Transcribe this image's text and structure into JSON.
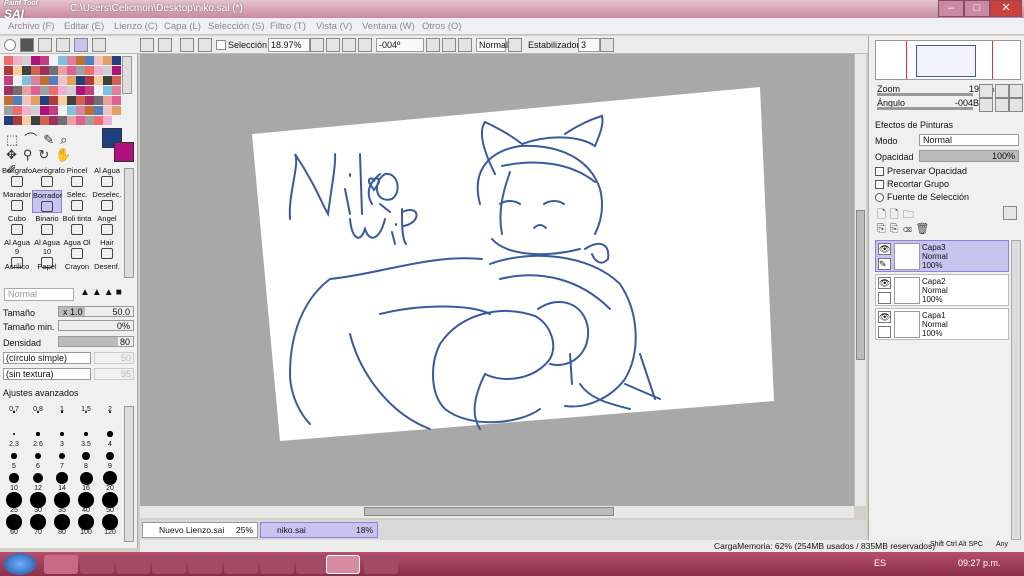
{
  "window": {
    "logo_small": "Paint Tool",
    "logo_big": "SAI",
    "title": "C:\\Users\\Celicmon\\Desktop\\niko.sai (*)",
    "minimize": "–",
    "maximize": "□",
    "close": "✕"
  },
  "menu": [
    "Archivo (F)",
    "Editar (E)",
    "Lienzo (C)",
    "Capa (L)",
    "Selección (S)",
    "Filtro (T)",
    "Vista (V)",
    "Ventana (W)",
    "Otros (O)"
  ],
  "toolbar": {
    "selection_label": "Selección",
    "zoom": "18.97%",
    "angle": "-004º",
    "blend": "Normal",
    "stabilizer_label": "Estabilizador",
    "stabilizer": "3"
  },
  "tools": [
    [
      "Bolígrafo",
      "Aerógrafo",
      "Pincel",
      "Al Agua"
    ],
    [
      "Marador",
      "Borrador",
      "Selec.",
      "Deselec."
    ],
    [
      "Cubo",
      "Binario",
      "Boli tinta",
      "Angel"
    ],
    [
      "Al Agua 9",
      "Al Agua 10",
      "Agua Ol",
      "Hair"
    ],
    [
      "Acrílico",
      "Papel",
      "Crayon",
      "Desenf."
    ]
  ],
  "brush": {
    "mode": "Normal",
    "size_label": "Tamaño",
    "size_mult": "x 1.0",
    "size": "50.0",
    "min_label": "Tamaño min.",
    "min": "0%",
    "density_label": "Densidad",
    "density": "80",
    "shape": "(círculo simple)",
    "shape_val": "50",
    "texture": "(sin textura)",
    "texture_val": "95",
    "advanced": "Ajustes avanzados"
  },
  "dot_labels": [
    "0.7",
    "0.8",
    "1",
    "1.5",
    "2",
    "2.3",
    "2.6",
    "3",
    "3.5",
    "4",
    "5",
    "6",
    "7",
    "8",
    "9",
    "10",
    "12",
    "14",
    "16",
    "20",
    "25",
    "30",
    "35",
    "40",
    "50",
    "60",
    "70",
    "80",
    "100",
    "120"
  ],
  "navigator": {
    "zoom_label": "Zoom",
    "zoom": "19.0%",
    "angle_label": "Ángulo",
    "angle": "-004B"
  },
  "layer_panel": {
    "effects": "Efectos de Pinturas",
    "mode_label": "Modo",
    "mode": "Normal",
    "opacity_label": "Opacidad",
    "opacity": "100%",
    "preserve": "Preservar Opacidad",
    "clip": "Recortar Grupo",
    "source": "Fuente de Selección"
  },
  "layers": [
    {
      "name": "Capa3",
      "mode": "Normal",
      "opacity": "100%"
    },
    {
      "name": "Capa2",
      "mode": "Normal",
      "opacity": "100%"
    },
    {
      "name": "Capa1",
      "mode": "Normal",
      "opacity": "100%"
    }
  ],
  "documents": [
    {
      "name": "Nuevo Lienzo.sai",
      "zoom": "25%"
    },
    {
      "name": "niko.sai",
      "zoom": "18%"
    }
  ],
  "status": {
    "memory": "CargaMemoria: 62% (254MB usados / 835MB reservados)",
    "keys": "Shift Ctrl Alt SPC",
    "any": "Any"
  },
  "taskbar": {
    "lang": "ES",
    "time": "09:27 p.m."
  },
  "colors": {
    "primary": "#1c3f7e",
    "secondary": "#b0127c",
    "sketch": "#3a5aa0"
  }
}
